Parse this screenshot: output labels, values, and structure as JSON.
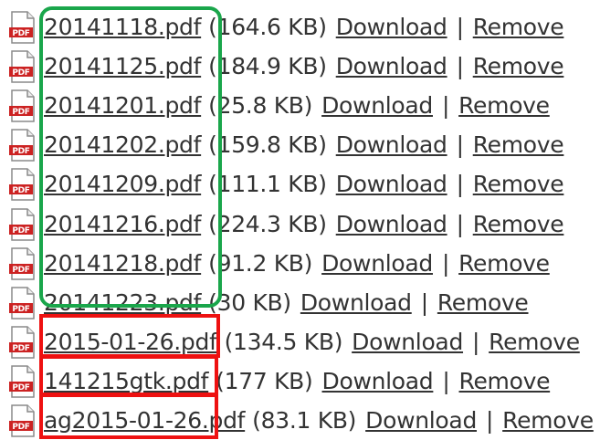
{
  "files": [
    {
      "name": "20141118.pdf",
      "size": "(164.6 KB)"
    },
    {
      "name": "20141125.pdf",
      "size": "(184.9 KB)"
    },
    {
      "name": "20141201.pdf",
      "size": "(25.8 KB)"
    },
    {
      "name": "20141202.pdf",
      "size": "(159.8 KB)"
    },
    {
      "name": "20141209.pdf",
      "size": "(111.1 KB)"
    },
    {
      "name": "20141216.pdf",
      "size": "(224.3 KB)"
    },
    {
      "name": "20141218.pdf",
      "size": "(91.2 KB)"
    },
    {
      "name": "20141223.pdf",
      "size": "(30 KB)"
    },
    {
      "name": "2015-01-26.pdf",
      "size": "(134.5 KB)"
    },
    {
      "name": "141215gtk.pdf",
      "size": "(177 KB)"
    },
    {
      "name": "ag2015-01-26.pdf",
      "size": "(83.1 KB)"
    }
  ],
  "actions": {
    "download_label": "Download",
    "separator": "|",
    "remove_label": "Remove"
  },
  "icon": {
    "name": "pdf-file-icon",
    "label": "PDF"
  },
  "colors": {
    "text": "#333333",
    "icon_red": "#cc2222",
    "highlight_green": "#1aa64b",
    "highlight_red": "#ee1111"
  }
}
